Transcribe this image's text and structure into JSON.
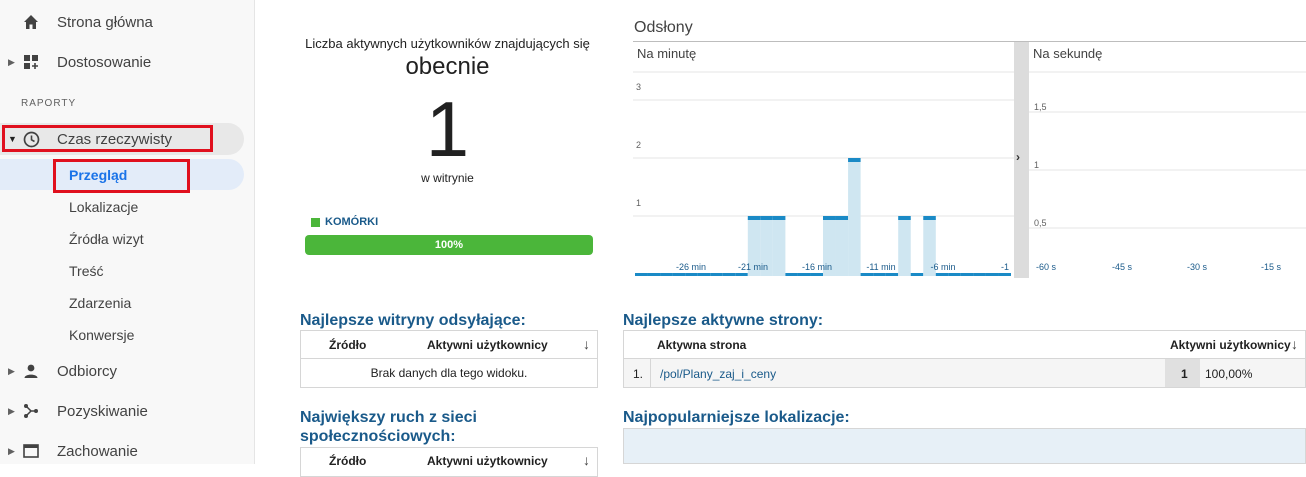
{
  "sidebar": {
    "home": "Strona główna",
    "customization": "Dostosowanie",
    "section_reports": "RAPORTY",
    "realtime": "Czas rzeczywisty",
    "sub_items": [
      "Przegląd",
      "Lokalizacje",
      "Źródła wizyt",
      "Treść",
      "Zdarzenia",
      "Konwersje"
    ],
    "audience": "Odbiorcy",
    "acquisition": "Pozyskiwanie",
    "behavior": "Zachowanie"
  },
  "active_users": {
    "title": "Liczba aktywnych użytkowników znajdujących się",
    "now": "obecnie",
    "count": "1",
    "subtitle": "w witrynie",
    "device_label": "KOMÓRKI",
    "device_percent": "100%",
    "device_fraction": 1.0
  },
  "pageviews": {
    "title": "Odsłony",
    "per_minute_label": "Na minutę",
    "per_second_label": "Na sekundę"
  },
  "chart_data": [
    {
      "type": "bar",
      "title": "Na minutę",
      "x_ticks": [
        "-26 min",
        "-21 min",
        "-16 min",
        "-11 min",
        "-6 min",
        "-1"
      ],
      "y_ticks": [
        "1",
        "2",
        "3"
      ],
      "ylim": [
        0,
        3.4
      ],
      "x": [
        -30,
        -29,
        -28,
        -27,
        -26,
        -25,
        -24,
        -23,
        -22,
        -21,
        -20,
        -19,
        -18,
        -17,
        -16,
        -15,
        -14,
        -13,
        -12,
        -11,
        -10,
        -9,
        -8,
        -7,
        -6,
        -5,
        -4,
        -3,
        -2,
        -1
      ],
      "values": [
        0,
        0,
        0,
        0,
        0,
        0,
        0,
        0,
        0,
        1,
        1,
        1,
        0,
        0,
        0,
        1,
        1,
        2,
        0,
        0,
        0,
        1,
        0,
        1,
        0,
        0,
        0,
        0,
        0,
        0
      ]
    },
    {
      "type": "bar",
      "title": "Na sekundę",
      "x_ticks": [
        "-60 s",
        "-45 s",
        "-30 s",
        "-15 s"
      ],
      "y_ticks": [
        "0,5",
        "1",
        "1,5"
      ],
      "ylim": [
        0,
        1.7
      ],
      "values": []
    }
  ],
  "referrals": {
    "title": "Najlepsze witryny odsyłające:",
    "col_source": "Źródło",
    "col_users": "Aktywni użytkownicy",
    "empty": "Brak danych dla tego widoku."
  },
  "top_pages": {
    "title": "Najlepsze aktywne strony:",
    "col_page": "Aktywna strona",
    "col_users": "Aktywni użytkownicy",
    "rows": [
      {
        "index": "1.",
        "page": "/pol/Plany_zaj_i_ceny",
        "users": "1",
        "percent": "100,00%"
      }
    ]
  },
  "social": {
    "title_line1": "Największy ruch z sieci",
    "title_line2": "społecznościowych:",
    "col_source": "Źródło",
    "col_users": "Aktywni użytkownicy"
  },
  "locations": {
    "title": "Najpopularniejsze lokalizacje:"
  },
  "colors": {
    "accent": "#1a5a8a",
    "device_bar": "#4bb63a",
    "chart_bar": "#cfe6f1",
    "chart_line": "#1a8ac6",
    "highlight_box": "#e0101e"
  }
}
